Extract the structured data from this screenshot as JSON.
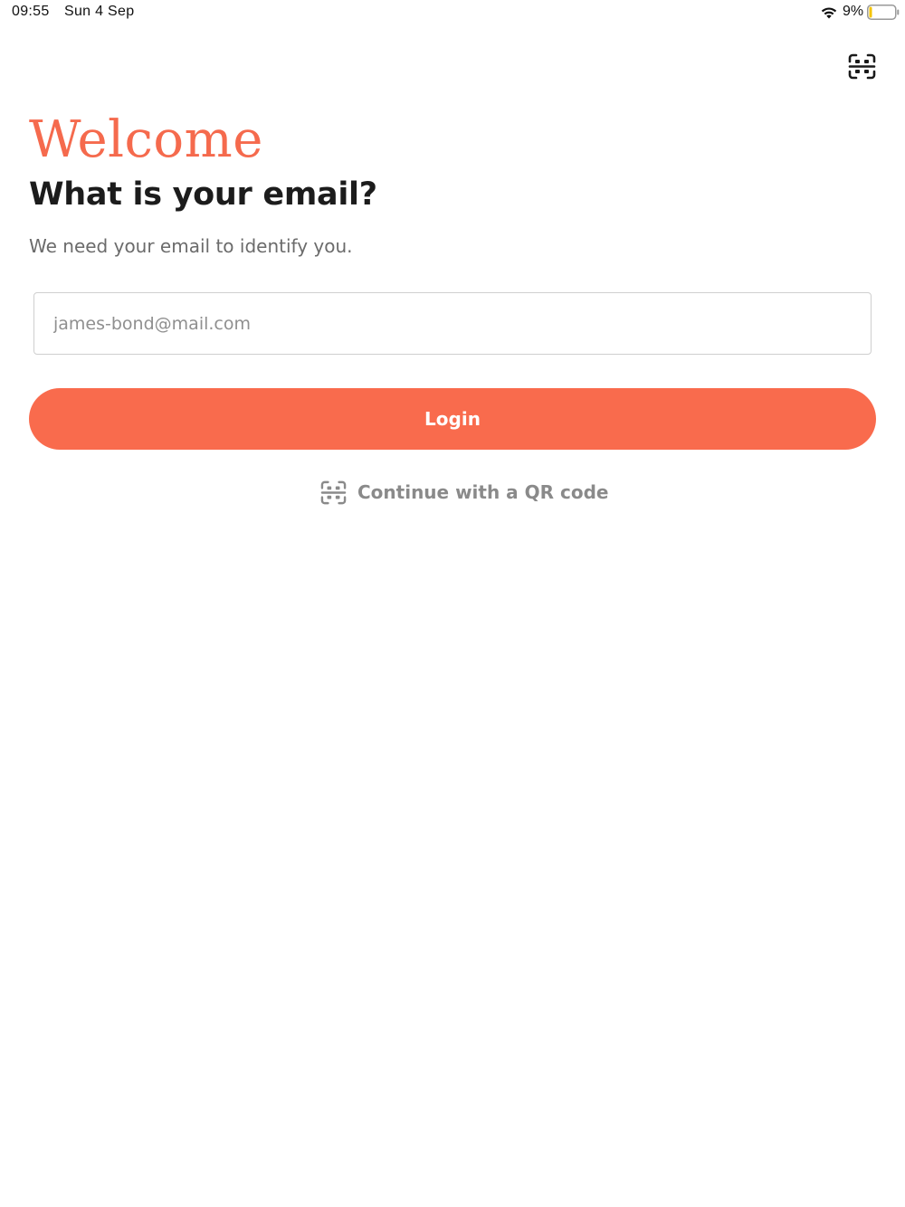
{
  "status_bar": {
    "time": "09:55",
    "date": "Sun 4 Sep",
    "battery_percent": "9%",
    "battery_level": 0.09,
    "battery_color": "#f5c400",
    "icons": [
      "wifi-icon",
      "battery-icon"
    ]
  },
  "header": {
    "scan_icon": "qr-scan-icon"
  },
  "main": {
    "welcome": "Welcome",
    "question": "What is your email?",
    "subtitle": "We need your email to identify you.",
    "email_field": {
      "placeholder": "james-bond@mail.com",
      "value": ""
    },
    "login_label": "Login",
    "qr_link_label": "Continue with a QR code"
  },
  "colors": {
    "accent": "#f96b4d",
    "heading": "#1c1c1c",
    "muted": "#8a8a8a"
  }
}
